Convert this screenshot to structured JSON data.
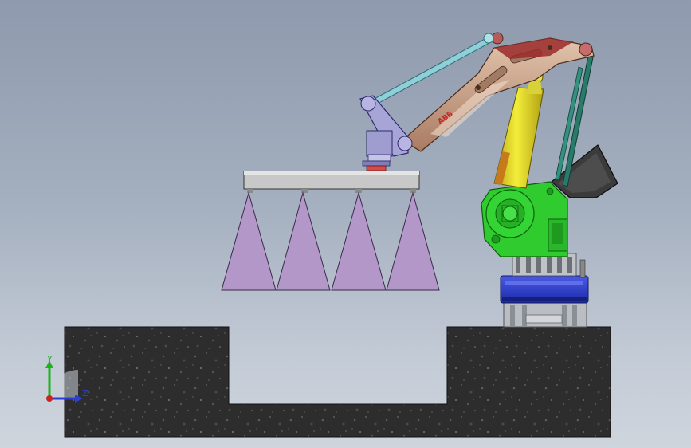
{
  "viewport": {
    "background_top": "#8e9aad",
    "background_bottom": "#cfd5dd"
  },
  "robot": {
    "logo_text": "ABB",
    "base_color": "#2f3fd0",
    "turret_color": "#2ec42e",
    "arm_color": "#c9a28a",
    "cylinder_color": "#e9e22a",
    "link_color": "#2a7a6a",
    "counterweight_color": "#2e2e2e"
  },
  "gripper": {
    "suction_cups": 4,
    "cup_color": "#b397c9",
    "beam_color": "#c7c7c7"
  },
  "floor": {
    "color": "#2e2e2e"
  },
  "triad": {
    "y_label": "Y",
    "z_label": "Z",
    "y_color": "#1db31d",
    "z_color": "#2a3fd6",
    "origin_color": "#d02020"
  }
}
